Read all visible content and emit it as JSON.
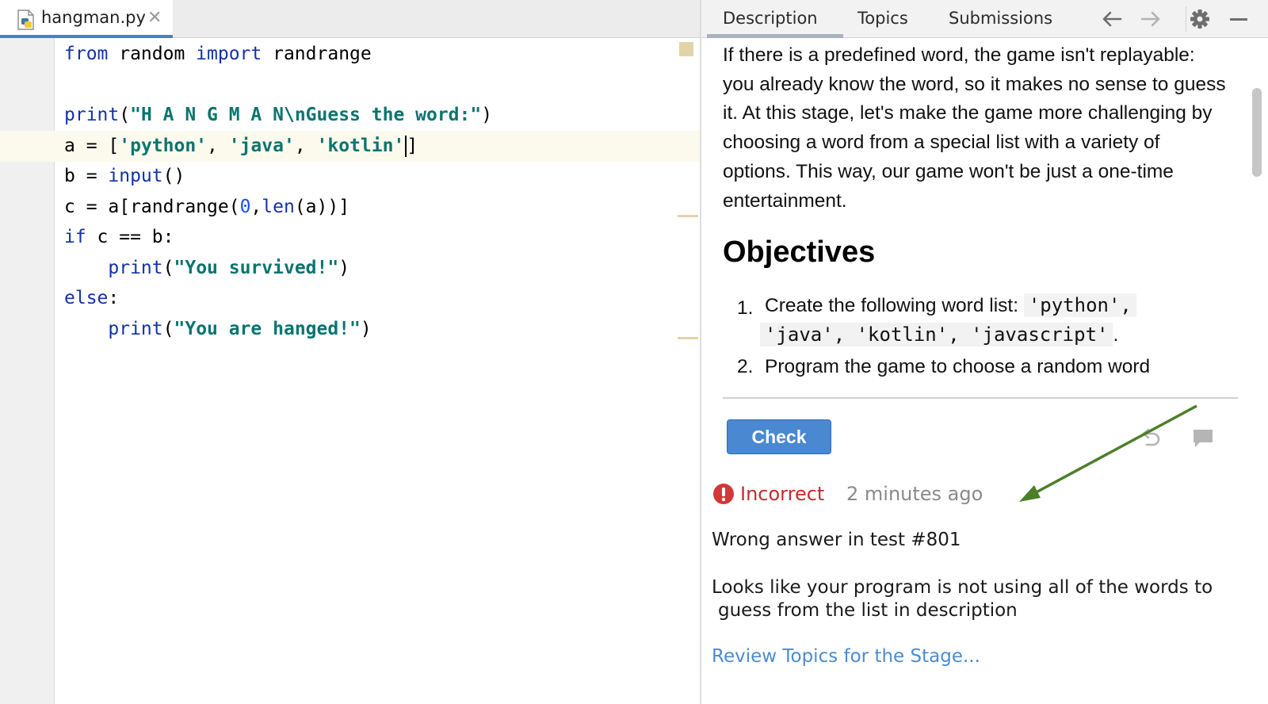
{
  "editor": {
    "tab": {
      "filename": "hangman.py",
      "close": "✕"
    },
    "code": {
      "line1": {
        "kw1": "from",
        "mod": " random ",
        "kw2": "import",
        "name": " randrange"
      },
      "line3": {
        "fn": "print",
        "open": "(",
        "str": "\"H A N G M A N\\nGuess the word:\"",
        "close": ")"
      },
      "line4": {
        "pre": "a = [",
        "s1": "'python'",
        "c1": ", ",
        "s2": "'java'",
        "c2": ", ",
        "s3": "'kotlin'",
        "post": "]"
      },
      "line5": {
        "pre": "b = ",
        "fn": "input",
        "post": "()"
      },
      "line6": {
        "pre": "c = a[randrange(",
        "num": "0",
        "comma": ",",
        "fn": "len",
        "post": "(a))]"
      },
      "line7": {
        "kw": "if",
        "post": " c == b:"
      },
      "line8": {
        "indent": "    ",
        "fn": "print",
        "open": "(",
        "str": "\"You survived!\"",
        "close": ")"
      },
      "line9": {
        "kw": "else",
        "post": ":"
      },
      "line10": {
        "indent": "    ",
        "fn": "print",
        "open": "(",
        "str": "\"You are hanged!\"",
        "close": ")"
      }
    }
  },
  "panel": {
    "tabs": [
      "Description",
      "Topics",
      "Submissions"
    ],
    "description": "If there is a predefined word, the game isn't replayable: you already know the word, so it makes no sense to guess it. At this stage, let's make the game more challenging by choosing a word from a special list with a variety of options. This way, our game won't be just a one-time entertainment.",
    "objectives_title": "Objectives",
    "objectives": {
      "item1_num": "1.",
      "item1_text": "Create the following word list: ",
      "item1_code_a": "'python',",
      "item1_code_b": "'java', 'kotlin', 'javascript'",
      "item1_end": ".",
      "item2_num": "2.",
      "item2_text": "Program the game to choose a random word"
    },
    "check_label": "Check",
    "status": {
      "label": "Incorrect",
      "time": "2 minutes ago",
      "color": "#c42b2b"
    },
    "message": {
      "line1": "Wrong answer in test #801",
      "line2a": "Looks like your program is not using all of the words to",
      "line2b": "guess from the list in description"
    },
    "review_link": "Review Topics for the Stage..."
  },
  "icons": {
    "toolbar": [
      "arrow-left-icon",
      "arrow-right-icon",
      "gear-icon",
      "minimize-icon"
    ],
    "actions": [
      "undo-icon",
      "comment-icon"
    ],
    "status": "error-icon",
    "file": "python-file-icon"
  },
  "colors": {
    "accent": "#4a88d2",
    "keyword": "#1232a8",
    "string": "#0b7470",
    "annotation_arrow": "#4b7f2a"
  }
}
